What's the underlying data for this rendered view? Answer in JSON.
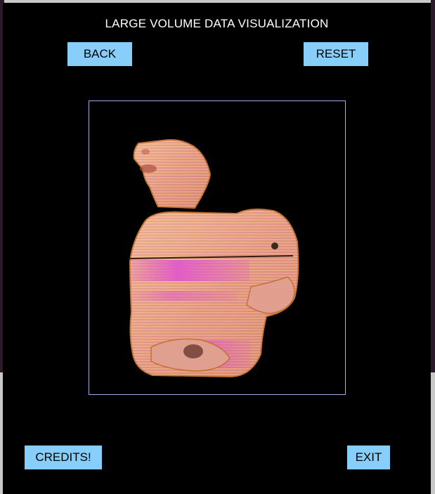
{
  "window": {
    "title": "LARGE VOLUME DATA VISUALIZATION"
  },
  "buttons": {
    "back": "BACK",
    "reset": "RESET",
    "credits": "CREDITS!",
    "exit": "EXIT"
  },
  "colors": {
    "background": "#000000",
    "button": "#87cefa",
    "viewport_border": "#9fb0e0",
    "render_primary": "#e8a8a0",
    "render_highlight": "#e060d0",
    "render_edge": "#d89020"
  }
}
